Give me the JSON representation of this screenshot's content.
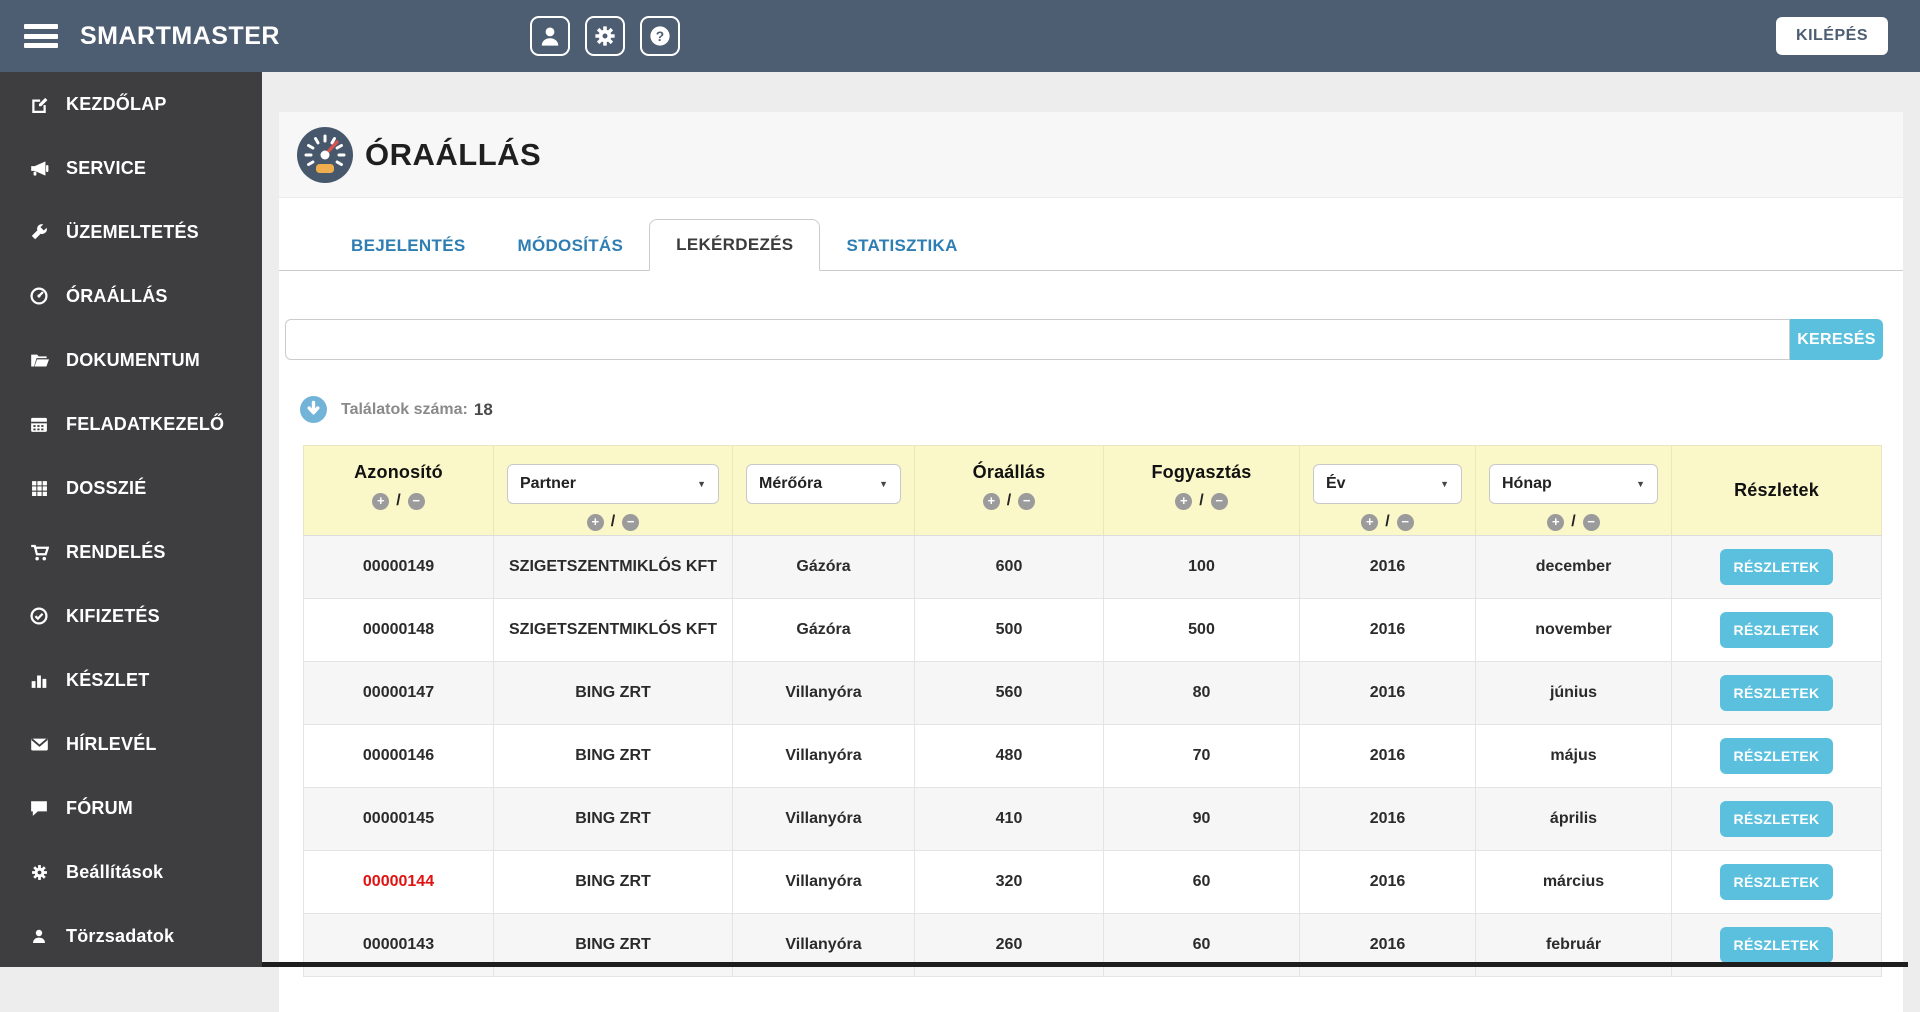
{
  "colors": {
    "topbar": "#4d5d72",
    "sidebar": "#3e3d3f",
    "accent_blue": "#5bc0de",
    "link_blue": "#2e7eb3",
    "header_yellow": "#faf7c8",
    "alert_red": "#e11212"
  },
  "topbar": {
    "brand": "SMARTMASTER",
    "logout_label": "KILÉPÉS",
    "icons": [
      "user-icon",
      "gear-icon",
      "help-icon"
    ]
  },
  "sidebar": {
    "items": [
      {
        "label": "KEZDŐLAP",
        "icon": "pencil-square-icon"
      },
      {
        "label": "SERVICE",
        "icon": "megaphone-icon"
      },
      {
        "label": "ÜZEMELTETÉS",
        "icon": "wrench-icon"
      },
      {
        "label": "ÓRAÁLLÁS",
        "icon": "gauge-icon"
      },
      {
        "label": "DOKUMENTUM",
        "icon": "folder-icon"
      },
      {
        "label": "FELADATKEZELŐ",
        "icon": "calendar-icon"
      },
      {
        "label": "DOSSZIÉ",
        "icon": "grid-icon"
      },
      {
        "label": "RENDELÉS",
        "icon": "cart-icon"
      },
      {
        "label": "KIFIZETÉS",
        "icon": "check-circle-icon"
      },
      {
        "label": "KÉSZLET",
        "icon": "bar-chart-icon"
      },
      {
        "label": "HÍRLEVÉL",
        "icon": "envelope-icon"
      },
      {
        "label": "FÓRUM",
        "icon": "comment-icon"
      },
      {
        "label": "Beállítások",
        "icon": "gear-icon"
      },
      {
        "label": "Törzsadatok",
        "icon": "user-icon"
      }
    ]
  },
  "page": {
    "title": "ÓRAÁLLÁS",
    "tabs": [
      {
        "label": "BEJELENTÉS",
        "active": false
      },
      {
        "label": "MÓDOSÍTÁS",
        "active": false
      },
      {
        "label": "LEKÉRDEZÉS",
        "active": true
      },
      {
        "label": "STATISZTIKA",
        "active": false
      }
    ],
    "search": {
      "value": "",
      "placeholder": "",
      "button_label": "KERESÉS"
    },
    "results": {
      "label": "Találatok száma:",
      "count": "18"
    }
  },
  "table": {
    "columns": [
      {
        "label": "Azonosító",
        "filter_select": false,
        "sortable": true
      },
      {
        "label": "Partner",
        "filter_select": true,
        "sortable": true
      },
      {
        "label": "Mérőóra",
        "filter_select": true,
        "sortable": false
      },
      {
        "label": "Óraállás",
        "filter_select": false,
        "sortable": true
      },
      {
        "label": "Fogyasztás",
        "filter_select": false,
        "sortable": true
      },
      {
        "label": "Év",
        "filter_select": true,
        "sortable": true
      },
      {
        "label": "Hónap",
        "filter_select": true,
        "sortable": true
      },
      {
        "label": "Részletek",
        "filter_select": false,
        "sortable": false
      }
    ],
    "details_button_label": "RÉSZLETEK",
    "rows": [
      {
        "id": "00000149",
        "partner": "SZIGETSZENTMIKLÓS KFT",
        "meter": "Gázóra",
        "reading": "600",
        "consumption": "100",
        "year": "2016",
        "month": "december",
        "id_red": false
      },
      {
        "id": "00000148",
        "partner": "SZIGETSZENTMIKLÓS KFT",
        "meter": "Gázóra",
        "reading": "500",
        "consumption": "500",
        "year": "2016",
        "month": "november",
        "id_red": false
      },
      {
        "id": "00000147",
        "partner": "BING ZRT",
        "meter": "Villanyóra",
        "reading": "560",
        "consumption": "80",
        "year": "2016",
        "month": "június",
        "id_red": false
      },
      {
        "id": "00000146",
        "partner": "BING ZRT",
        "meter": "Villanyóra",
        "reading": "480",
        "consumption": "70",
        "year": "2016",
        "month": "május",
        "id_red": false
      },
      {
        "id": "00000145",
        "partner": "BING ZRT",
        "meter": "Villanyóra",
        "reading": "410",
        "consumption": "90",
        "year": "2016",
        "month": "április",
        "id_red": false
      },
      {
        "id": "00000144",
        "partner": "BING ZRT",
        "meter": "Villanyóra",
        "reading": "320",
        "consumption": "60",
        "year": "2016",
        "month": "március",
        "id_red": true
      },
      {
        "id": "00000143",
        "partner": "BING ZRT",
        "meter": "Villanyóra",
        "reading": "260",
        "consumption": "60",
        "year": "2016",
        "month": "február",
        "id_red": false
      }
    ]
  }
}
